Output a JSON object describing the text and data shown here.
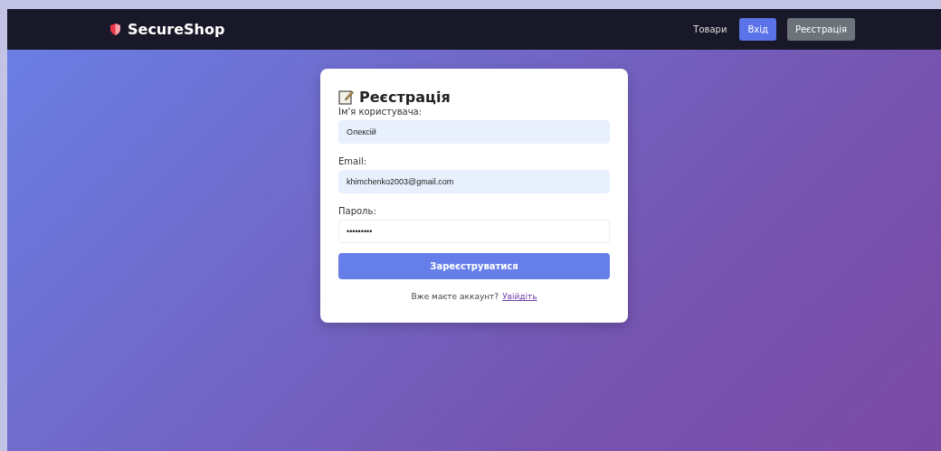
{
  "navbar": {
    "brand": "SecureShop",
    "links": [
      {
        "label": "Товари",
        "kind": "link"
      },
      {
        "label": "Вхід",
        "kind": "primary"
      },
      {
        "label": "Реєстрація",
        "kind": "secondary"
      }
    ]
  },
  "form": {
    "title": "Реєстрація",
    "fields": [
      {
        "label": "Ім'я користувача:",
        "value": "Олексій",
        "autofilled": true
      },
      {
        "label": "Email:",
        "value": "khimchenko2003@gmail.com",
        "autofilled": true
      },
      {
        "label": "Пароль:",
        "value": "•••••••••",
        "autofilled": false
      }
    ],
    "submit": "Зареєструватися",
    "footer_text": "Вже маєте аккаунт?",
    "footer_link": "Увійдіть"
  }
}
